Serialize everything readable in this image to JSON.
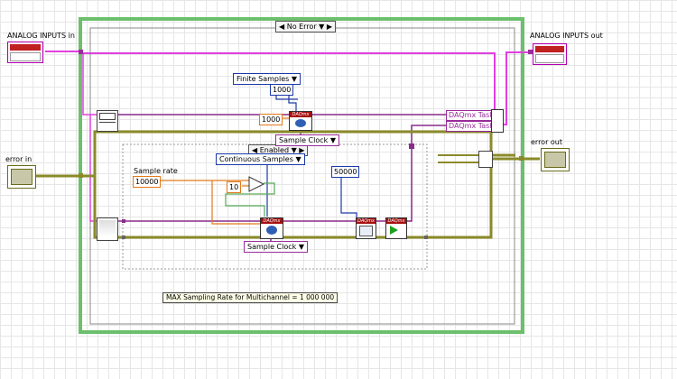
{
  "terminals": {
    "analog_in": "ANALOG INPUTS in",
    "analog_out": "ANALOG INPUTS out",
    "error_in": "error in",
    "error_out": "error out"
  },
  "case_selector_outer": "No Error",
  "case_selector_inner": "Enabled",
  "constants": {
    "finite_samples": "Finite Samples",
    "finite_count": "1000",
    "rate_1000": "1000",
    "sample_clock_1": "Sample Clock",
    "continuous_samples": "Continuous Samples",
    "sample_rate_label": "Sample rate",
    "sample_rate_value": "10000",
    "ten": "10",
    "fifty_k": "50000",
    "sample_clock_2": "Sample Clock"
  },
  "task_labels": [
    "DAQmx Task",
    "DAQmx Task"
  ],
  "daqmx_badge": "DAQmx",
  "note": "MAX Sampling Rate for Multichannel = 1 000 000",
  "arrows": {
    "dropdown": "▼",
    "left": "◀",
    "right": "▶"
  }
}
